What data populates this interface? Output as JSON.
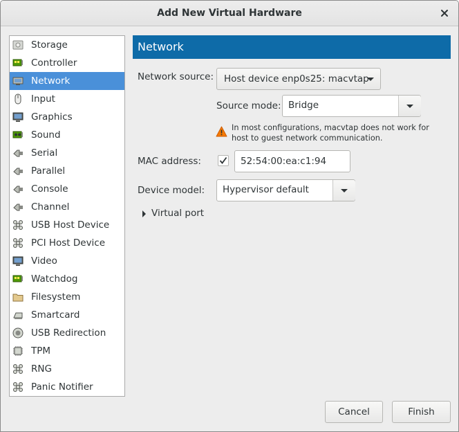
{
  "window": {
    "title": "Add New Virtual Hardware"
  },
  "sidebar": {
    "items": [
      {
        "label": "Storage",
        "icon": "storage-icon"
      },
      {
        "label": "Controller",
        "icon": "controller-icon"
      },
      {
        "label": "Network",
        "icon": "network-icon",
        "selected": true
      },
      {
        "label": "Input",
        "icon": "mouse-icon"
      },
      {
        "label": "Graphics",
        "icon": "monitor-icon"
      },
      {
        "label": "Sound",
        "icon": "sound-card-icon"
      },
      {
        "label": "Serial",
        "icon": "serial-port-icon"
      },
      {
        "label": "Parallel",
        "icon": "parallel-port-icon"
      },
      {
        "label": "Console",
        "icon": "console-port-icon"
      },
      {
        "label": "Channel",
        "icon": "channel-port-icon"
      },
      {
        "label": "USB Host Device",
        "icon": "usb-device-icon"
      },
      {
        "label": "PCI Host Device",
        "icon": "pci-device-icon"
      },
      {
        "label": "Video",
        "icon": "video-monitor-icon"
      },
      {
        "label": "Watchdog",
        "icon": "watchdog-card-icon"
      },
      {
        "label": "Filesystem",
        "icon": "folder-icon"
      },
      {
        "label": "Smartcard",
        "icon": "smartcard-reader-icon"
      },
      {
        "label": "USB Redirection",
        "icon": "usb-redirection-icon"
      },
      {
        "label": "TPM",
        "icon": "tpm-chip-icon"
      },
      {
        "label": "RNG",
        "icon": "rng-device-icon"
      },
      {
        "label": "Panic Notifier",
        "icon": "panic-notifier-icon"
      }
    ]
  },
  "panel": {
    "title": "Network",
    "network_source_label": "Network source:",
    "network_source_value": "Host device enp0s25: macvtap",
    "source_mode_label": "Source mode:",
    "source_mode_value": "Bridge",
    "warning_text": "In most configurations, macvtap does not work for host to guest network communication.",
    "mac_label": "MAC address:",
    "mac_checked": true,
    "mac_value": "52:54:00:ea:c1:94",
    "device_model_label": "Device model:",
    "device_model_value": "Hypervisor default",
    "virtual_port_label": "Virtual port"
  },
  "footer": {
    "cancel_label": "Cancel",
    "finish_label": "Finish"
  },
  "colors": {
    "accent": "#4a90d9",
    "header": "#0e6ba8",
    "warning": "#f57900"
  }
}
